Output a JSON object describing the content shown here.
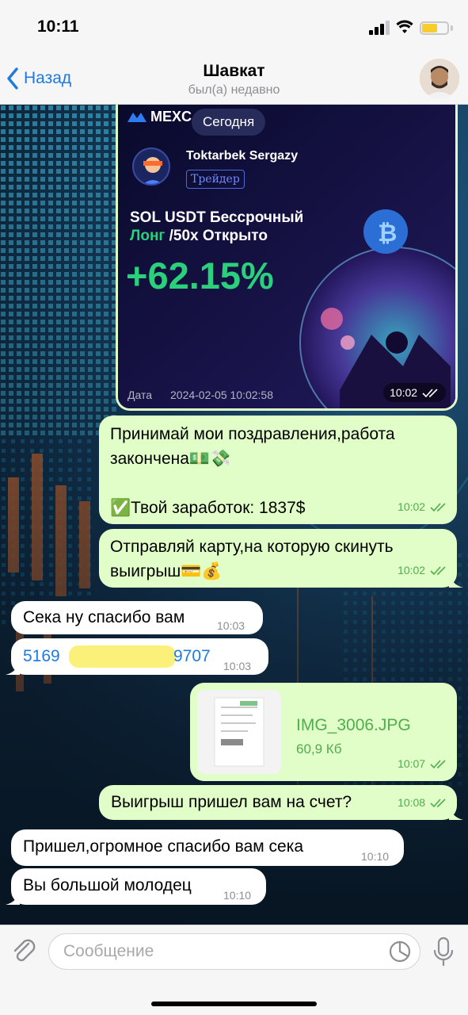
{
  "status": {
    "time": "10:11"
  },
  "header": {
    "back_label": "Назад",
    "title": "Шавкат",
    "subtitle": "был(а) недавно"
  },
  "card": {
    "brand": "MEXC",
    "date_pill": "Сегодня",
    "trader_name": "Toktarbek Sergazy",
    "trader_badge": "Трейдер",
    "pair": "SOL USDT Бессрочный",
    "side": "Лонг",
    "leverage": " /50x Открыто",
    "pnl": "+62.15%",
    "date_label": "Дата",
    "date_value": "2024-02-05 10:02:58",
    "time": "10:02"
  },
  "messages": [
    {
      "id": "m1",
      "direction": "out",
      "lines": [
        "Принимай мои поздравления,работа",
        "закончена💵💸",
        "",
        "✅Твой заработок: 1837$"
      ],
      "time": "10:02",
      "read": true
    },
    {
      "id": "m2",
      "direction": "out",
      "lines": [
        "Отправляй карту,на которую скинуть",
        "выигрыш💳💰"
      ],
      "time": "10:02",
      "read": true
    },
    {
      "id": "m3",
      "direction": "in",
      "text": "Сека ну спасибо вам",
      "time": "10:03"
    },
    {
      "id": "m4",
      "direction": "in",
      "text_start": "5169",
      "text_end": "9707",
      "time": "10:03"
    },
    {
      "id": "m5",
      "direction": "out",
      "type": "file",
      "file_name": "IMG_3006.JPG",
      "file_size": "60,9 Кб",
      "time": "10:07",
      "read": true
    },
    {
      "id": "m6",
      "direction": "out",
      "text": "Выигрыш пришел вам на счет?",
      "time": "10:08",
      "read": true
    },
    {
      "id": "m7",
      "direction": "in",
      "text": "Пришел,огромное спасибо вам сека",
      "time": "10:10"
    },
    {
      "id": "m8",
      "direction": "in",
      "text": "Вы большой молодец",
      "time": "10:10"
    }
  ],
  "input": {
    "placeholder": "Сообщение"
  },
  "colors": {
    "accent": "#1f7ae0",
    "bubble_out": "#e1fdc8",
    "bubble_in": "#ffffff",
    "time_out": "#4fae4e",
    "pnl_green": "#2bd07c"
  },
  "icons": [
    "chevron-left-icon",
    "paperclip-icon",
    "sticker-icon",
    "microphone-icon",
    "double-check-icon",
    "signal-icon",
    "wifi-icon",
    "battery-icon"
  ]
}
